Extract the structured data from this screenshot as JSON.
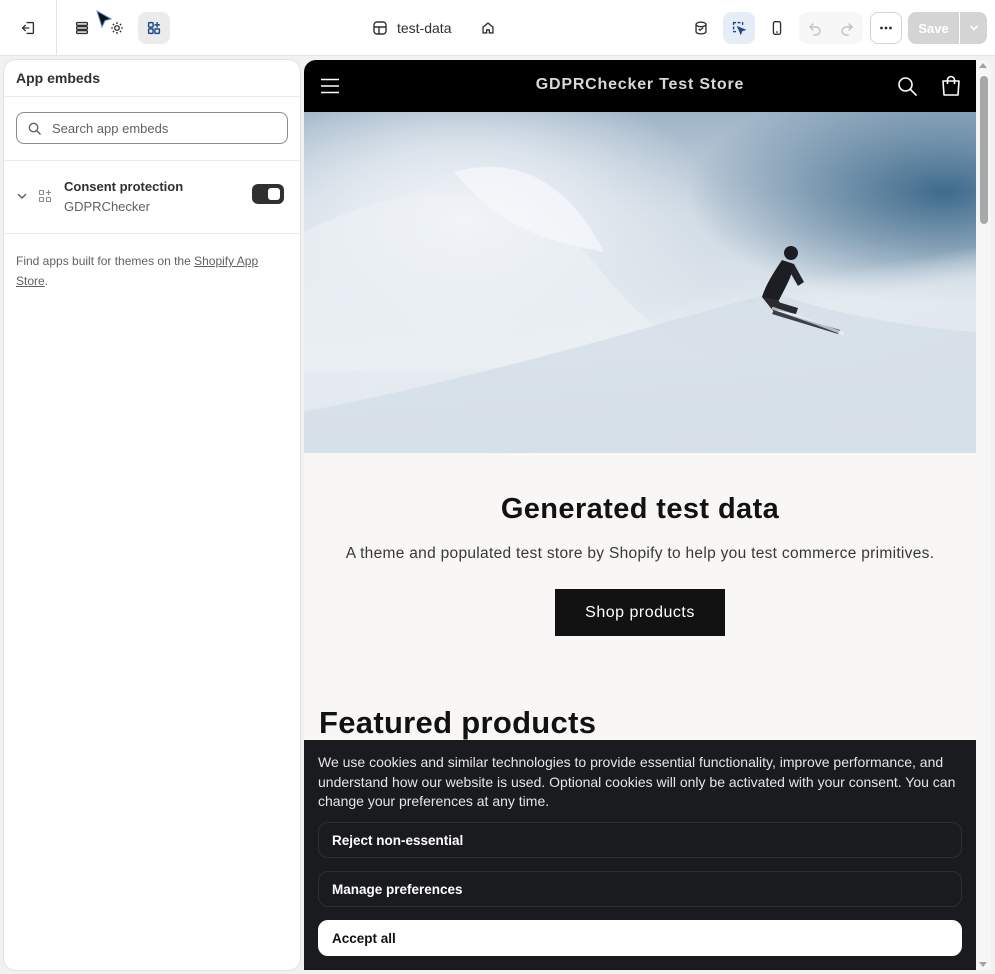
{
  "toolbar": {
    "theme_name": "test-data",
    "save_label": "Save"
  },
  "sidebar": {
    "title": "App embeds",
    "search_placeholder": "Search app embeds",
    "embed": {
      "title": "Consent protection",
      "app": "GDPRChecker",
      "enabled": true
    },
    "footer_text": "Find apps built for themes on the ",
    "footer_link": "Shopify App Store",
    "footer_end": "."
  },
  "store": {
    "name": "GDPRChecker Test Store",
    "hero_heading": "Generated test data",
    "hero_subheading": "A theme and populated test store by Shopify to help you test commerce primitives.",
    "cta_label": "Shop products",
    "featured_heading": "Featured products"
  },
  "cookie_banner": {
    "message": "We use cookies and similar technologies to provide essential functionality, improve performance, and understand how our website is used. Optional cookies will only be activated with your consent. You can change your preferences at any time.",
    "reject_label": "Reject non-essential",
    "manage_label": "Manage preferences",
    "accept_label": "Accept all"
  },
  "colors": {
    "accent": "#303030",
    "banner_bg": "#1a1b1f",
    "store_header_bg": "#000000"
  }
}
